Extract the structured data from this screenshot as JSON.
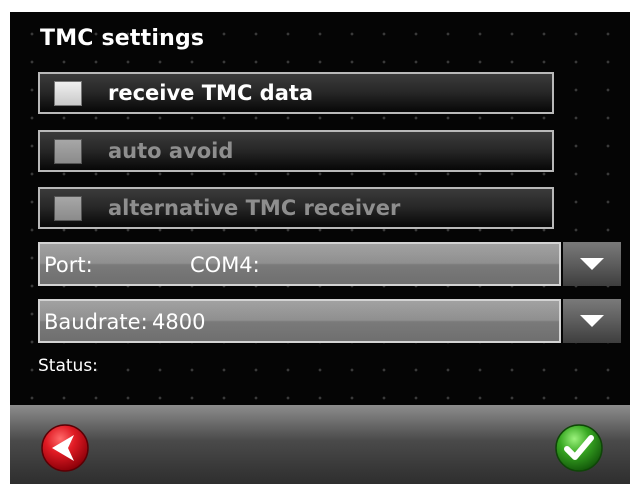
{
  "dialog": {
    "title": "TMC settings"
  },
  "options": [
    {
      "label": "receive TMC data",
      "checked": false,
      "enabled": true
    },
    {
      "label": "auto avoid",
      "checked": false,
      "enabled": false
    },
    {
      "label": "alternative TMC receiver",
      "checked": false,
      "enabled": false
    }
  ],
  "port": {
    "label": "Port:",
    "value": "COM4:"
  },
  "baudrate": {
    "label": "Baudrate:",
    "value": "4800"
  },
  "status": {
    "label": "Status:"
  },
  "colors": {
    "background": "#050505",
    "back_button": "#d2101c",
    "ok_button": "#2f9f1f"
  },
  "icons": {
    "back": "back-arrow-icon",
    "ok": "checkmark-icon",
    "dropdown": "dropdown-arrow-icon"
  }
}
